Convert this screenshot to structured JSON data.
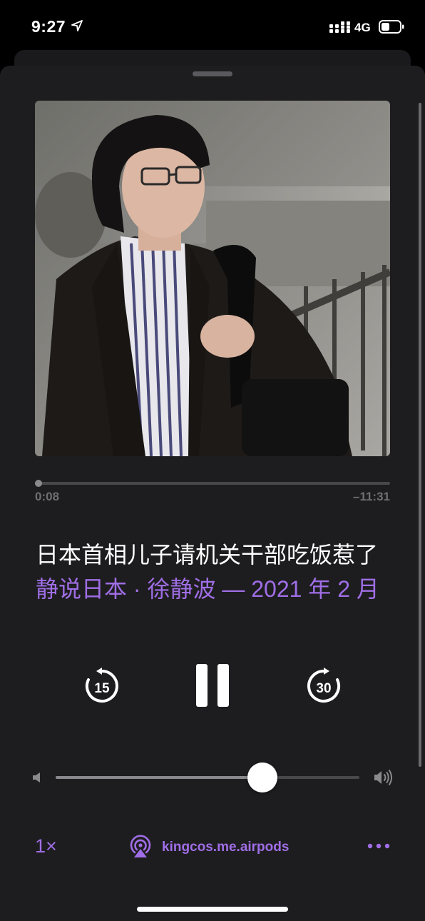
{
  "status_bar": {
    "time": "9:27",
    "network": "4G",
    "icons": [
      "location-arrow-icon",
      "cellular-signal-icon",
      "battery-icon"
    ]
  },
  "player": {
    "artwork": "podcast-artwork-photo",
    "progress": {
      "elapsed": "0:08",
      "remaining": "–11:31",
      "fraction": 0.011
    },
    "episode_title": "日本首相儿子请机关干部吃饭惹了",
    "show_line": "静说日本 · 徐静波 — 2021 年 2 月",
    "controls": {
      "skip_back_seconds": "15",
      "skip_forward_seconds": "30",
      "state_icon": "pause-icon"
    },
    "volume": {
      "fraction": 0.68
    },
    "speed": "1×",
    "airplay_device": "kingcos.me.airpods",
    "more_icon": "ellipsis-icon"
  },
  "colors": {
    "accent": "#a06ee6",
    "sheet_background": "#1d1d1f",
    "page_background": "#000000",
    "secondary_text": "#6e6e73"
  }
}
